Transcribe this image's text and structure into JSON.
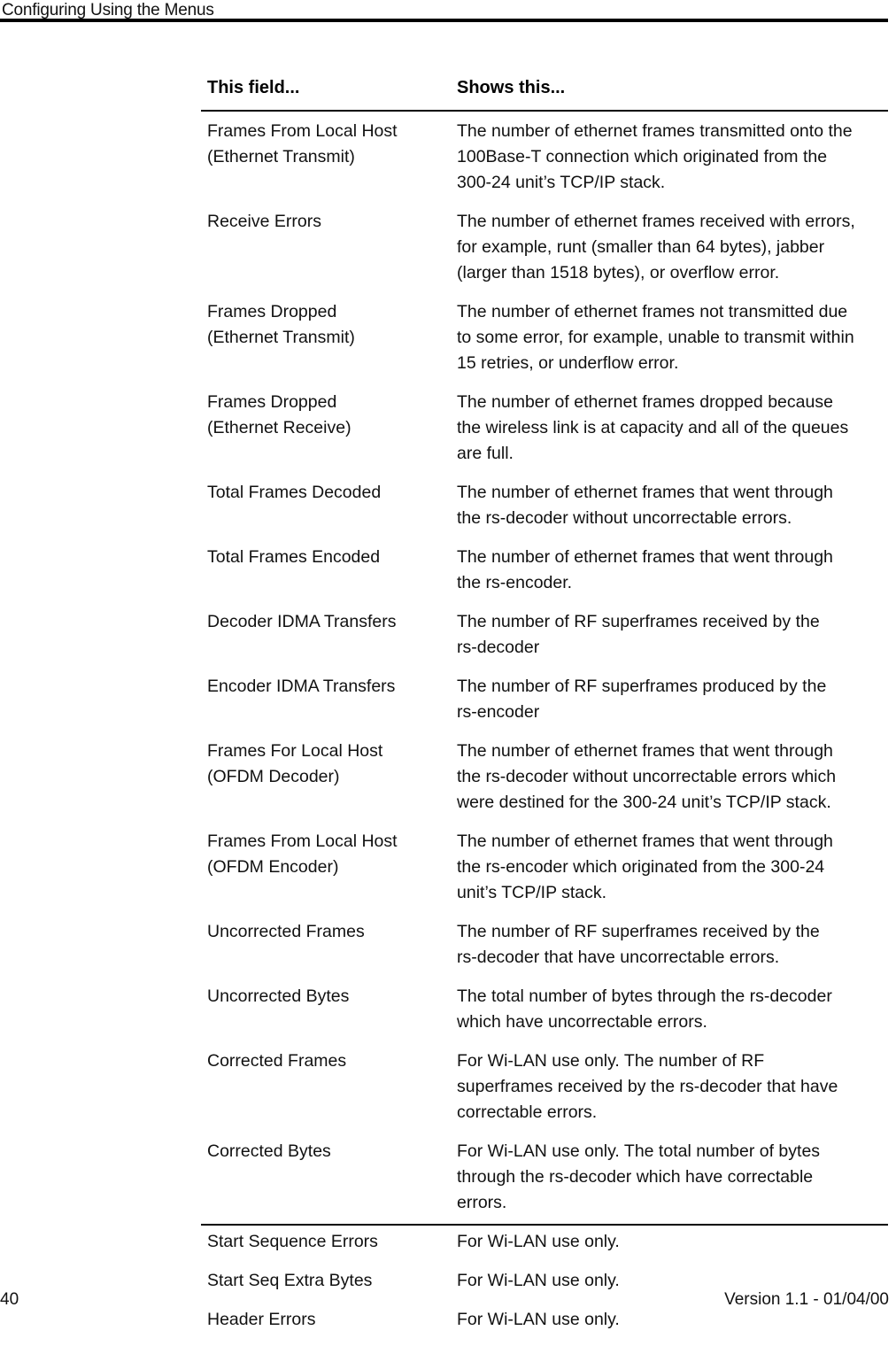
{
  "header": {
    "title": "Configuring Using the Menus"
  },
  "table": {
    "columns": {
      "field_header": "This field...",
      "description_header": "Shows this..."
    },
    "rows": [
      {
        "field_lines": [
          "Frames From Local Host",
          "(Ethernet Transmit)"
        ],
        "description_lines": [
          "The number of ethernet frames transmitted onto the",
          "100Base-T connection which originated from the",
          "300-24 unit’s TCP/IP stack."
        ]
      },
      {
        "field_lines": [
          "Receive Errors"
        ],
        "description_lines": [
          "The number of ethernet frames received with errors,",
          "for example, runt (smaller than 64 bytes), jabber",
          "(larger than 1518 bytes), or overflow error."
        ]
      },
      {
        "field_lines": [
          "Frames Dropped",
          "(Ethernet Transmit)"
        ],
        "description_lines": [
          "The number of ethernet frames not transmitted due",
          "to some error, for example, unable to transmit within",
          "15 retries, or underflow error."
        ]
      },
      {
        "field_lines": [
          "Frames Dropped",
          "(Ethernet Receive)"
        ],
        "description_lines": [
          "The number of ethernet frames dropped because",
          "the wireless link is at capacity and all of the queues",
          "are full."
        ]
      },
      {
        "field_lines": [
          "Total Frames Decoded"
        ],
        "description_lines": [
          "The number of ethernet frames that went through",
          "the rs-decoder without uncorrectable errors."
        ]
      },
      {
        "field_lines": [
          "Total Frames Encoded"
        ],
        "description_lines": [
          "The number of ethernet frames that went through",
          "the rs-encoder."
        ]
      },
      {
        "field_lines": [
          "Decoder IDMA Transfers"
        ],
        "description_lines": [
          "The number of RF superframes received by the",
          "rs-decoder"
        ]
      },
      {
        "field_lines": [
          "Encoder IDMA Transfers"
        ],
        "description_lines": [
          "The number of RF superframes produced by the",
          "rs-encoder"
        ]
      },
      {
        "field_lines": [
          "Frames For Local Host",
          "(OFDM Decoder)"
        ],
        "description_lines": [
          "The number of ethernet frames that went through",
          "the rs-decoder without uncorrectable errors which",
          "were destined for the 300-24 unit’s TCP/IP stack."
        ]
      },
      {
        "field_lines": [
          "Frames From Local Host",
          "(OFDM Encoder)"
        ],
        "description_lines": [
          "The number of ethernet frames that went through",
          "the rs-encoder which originated from the 300-24",
          "unit’s TCP/IP stack."
        ]
      },
      {
        "field_lines": [
          "Uncorrected Frames"
        ],
        "description_lines": [
          "The number of RF superframes received by the",
          "rs-decoder that have uncorrectable errors."
        ]
      },
      {
        "field_lines": [
          "Uncorrected Bytes"
        ],
        "description_lines": [
          "The total number of bytes through the rs-decoder",
          "which have uncorrectable errors."
        ]
      },
      {
        "field_lines": [
          "Corrected Frames"
        ],
        "description_lines": [
          "For Wi-LAN use only. The number of RF",
          "superframes received by the rs-decoder that have",
          "correctable errors."
        ]
      },
      {
        "field_lines": [
          "Corrected Bytes"
        ],
        "description_lines": [
          "For Wi-LAN use only. The total number of bytes",
          "through the rs-decoder which have correctable",
          "errors."
        ]
      },
      {
        "field_lines": [
          "Start Sequence Errors"
        ],
        "description_lines": [
          "For Wi-LAN use only."
        ]
      },
      {
        "field_lines": [
          "Start Seq Extra Bytes"
        ],
        "description_lines": [
          "For Wi-LAN use only."
        ]
      },
      {
        "field_lines": [
          "Header Errors"
        ],
        "description_lines": [
          "For Wi-LAN use only."
        ]
      }
    ]
  },
  "footer": {
    "page_number": "40",
    "version_text": "Version 1.1 - 01/04/00"
  }
}
